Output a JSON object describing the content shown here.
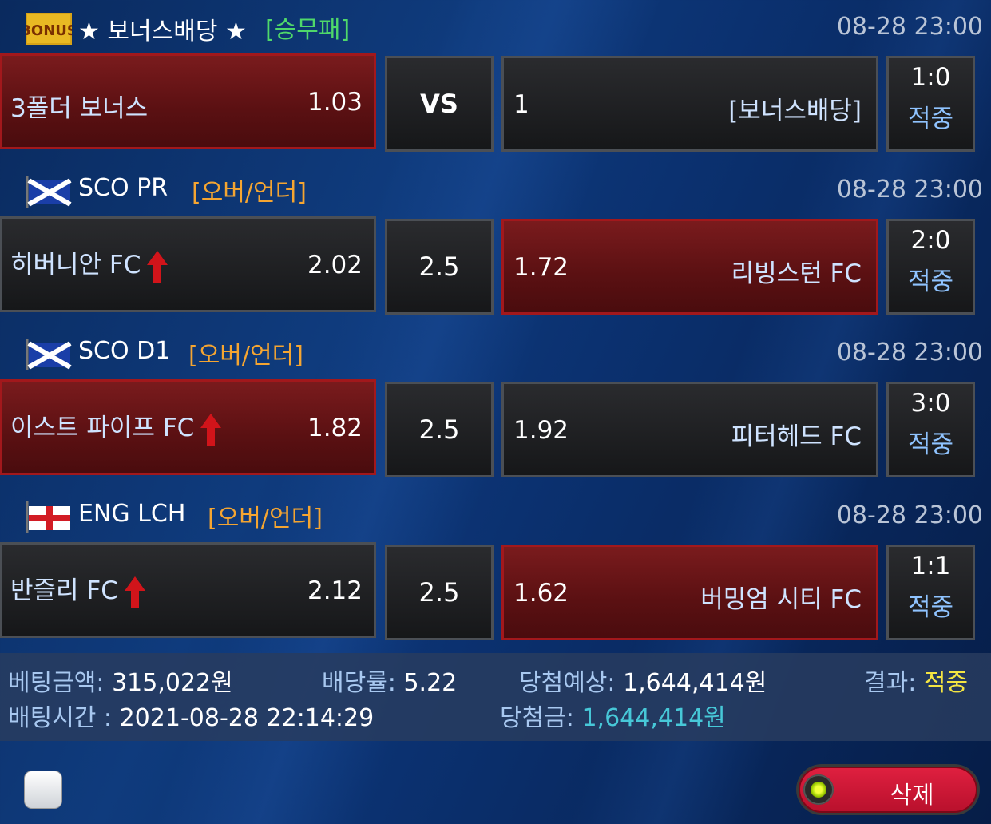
{
  "colors": {
    "accent_green": "#4fd86a",
    "accent_orange": "#f5a531",
    "result_blue": "#8fc3ff",
    "selected_red": "#7a1b1d",
    "yellow": "#f4e542",
    "cyan": "#47c8d8"
  },
  "matches": [
    {
      "flag": "bonus-badge",
      "league": "★ 보너스배당 ★",
      "market": "[승무패]",
      "market_color": "#4fd86a",
      "time": "08-28 23:00",
      "home": {
        "name": "3폴더 보너스",
        "odd": "1.03",
        "selected": true,
        "arrow": false
      },
      "center": "VS",
      "away": {
        "name": "[보너스배당]",
        "odd": "1",
        "selected": false
      },
      "score": "1:0",
      "result": "적중"
    },
    {
      "flag": "scotland-flag-icon",
      "league": "SCO PR",
      "market": "[오버/언더]",
      "market_color": "#f5a531",
      "time": "08-28 23:00",
      "home": {
        "name": "히버니안 FC",
        "odd": "2.02",
        "selected": false,
        "arrow": true
      },
      "center": "2.5",
      "away": {
        "name": "리빙스턴 FC",
        "odd": "1.72",
        "selected": true
      },
      "score": "2:0",
      "result": "적중"
    },
    {
      "flag": "scotland-flag-icon",
      "league": "SCO D1",
      "market": "[오버/언더]",
      "market_color": "#f5a531",
      "time": "08-28 23:00",
      "home": {
        "name": "이스트 파이프 FC",
        "odd": "1.82",
        "selected": true,
        "arrow": true
      },
      "center": "2.5",
      "away": {
        "name": "피터헤드 FC",
        "odd": "1.92",
        "selected": false
      },
      "score": "3:0",
      "result": "적중"
    },
    {
      "flag": "england-flag-icon",
      "league": "ENG LCH",
      "market": "[오버/언더]",
      "market_color": "#f5a531",
      "time": "08-28 23:00",
      "home": {
        "name": "반즐리 FC",
        "odd": "2.12",
        "selected": false,
        "arrow": true
      },
      "center": "2.5",
      "away": {
        "name": "버밍엄 시티 FC",
        "odd": "1.62",
        "selected": true
      },
      "score": "1:1",
      "result": "적중"
    }
  ],
  "summary": {
    "bet_amount_label": "베팅금액:",
    "bet_amount": "315,022원",
    "odds_label": "배당률:",
    "odds": "5.22",
    "expected_label": "당첨예상:",
    "expected": "1,644,414원",
    "result_label": "결과:",
    "result": "적중",
    "bet_time_label": "배팅시간 :",
    "bet_time": "2021-08-28 22:14:29",
    "win_label": "당첨금:",
    "win": "1,644,414원"
  },
  "actions": {
    "delete_label": "삭제"
  }
}
